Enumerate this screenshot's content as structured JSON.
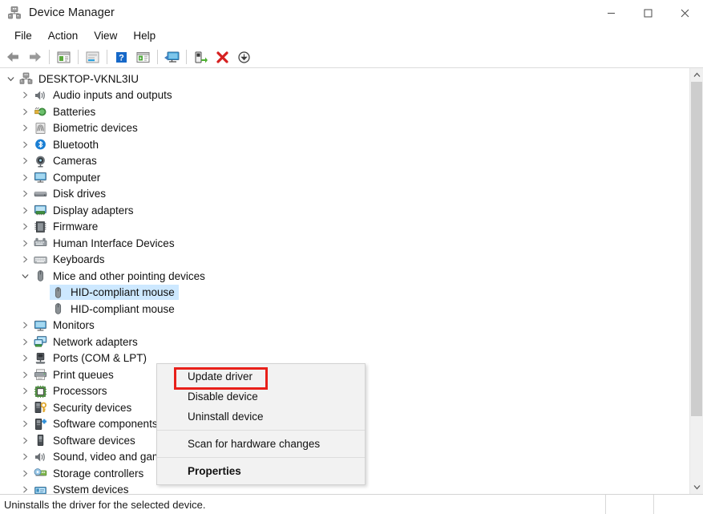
{
  "window": {
    "title": "Device Manager",
    "icon": "device-manager-icon",
    "minimize_label": "—",
    "maximize_label": "□",
    "close_label": "✕"
  },
  "menubar": {
    "items": [
      {
        "label": "File"
      },
      {
        "label": "Action"
      },
      {
        "label": "View"
      },
      {
        "label": "Help"
      }
    ]
  },
  "toolbar": {
    "buttons": [
      {
        "name": "back-icon",
        "tip": "Back"
      },
      {
        "name": "forward-icon",
        "tip": "Forward"
      },
      {
        "name": "properties-icon",
        "tip": "Properties"
      },
      {
        "name": "update-driver-icon",
        "tip": "Update driver"
      },
      {
        "name": "help-icon",
        "tip": "Help"
      },
      {
        "name": "show-hidden-devices-icon",
        "tip": "Show hidden devices"
      },
      {
        "name": "scan-hardware-changes-icon",
        "tip": "Scan for hardware changes"
      },
      {
        "name": "enable-device-icon",
        "tip": "Enable device"
      },
      {
        "name": "uninstall-device-icon",
        "tip": "Uninstall device"
      },
      {
        "name": "disable-device-icon",
        "tip": "Disable device"
      }
    ]
  },
  "tree": {
    "root": "DESKTOP-VKNL3IU",
    "nodes": [
      {
        "label": "DESKTOP-VKNL3IU",
        "depth": 0,
        "state": "expanded",
        "icon": "computer-root-icon",
        "selected": false
      },
      {
        "label": "Audio inputs and outputs",
        "depth": 1,
        "state": "collapsed",
        "icon": "speaker-icon",
        "selected": false
      },
      {
        "label": "Batteries",
        "depth": 1,
        "state": "collapsed",
        "icon": "battery-icon",
        "selected": false
      },
      {
        "label": "Biometric devices",
        "depth": 1,
        "state": "collapsed",
        "icon": "fingerprint-icon",
        "selected": false
      },
      {
        "label": "Bluetooth",
        "depth": 1,
        "state": "collapsed",
        "icon": "bluetooth-icon",
        "selected": false
      },
      {
        "label": "Cameras",
        "depth": 1,
        "state": "collapsed",
        "icon": "camera-icon",
        "selected": false
      },
      {
        "label": "Computer",
        "depth": 1,
        "state": "collapsed",
        "icon": "monitor-icon",
        "selected": false
      },
      {
        "label": "Disk drives",
        "depth": 1,
        "state": "collapsed",
        "icon": "disk-drive-icon",
        "selected": false
      },
      {
        "label": "Display adapters",
        "depth": 1,
        "state": "collapsed",
        "icon": "display-adapter-icon",
        "selected": false
      },
      {
        "label": "Firmware",
        "depth": 1,
        "state": "collapsed",
        "icon": "firmware-chip-icon",
        "selected": false
      },
      {
        "label": "Human Interface Devices",
        "depth": 1,
        "state": "collapsed",
        "icon": "hid-icon",
        "selected": false
      },
      {
        "label": "Keyboards",
        "depth": 1,
        "state": "collapsed",
        "icon": "keyboard-icon",
        "selected": false
      },
      {
        "label": "Mice and other pointing devices",
        "depth": 1,
        "state": "expanded",
        "icon": "mouse-icon",
        "selected": false
      },
      {
        "label": "HID-compliant mouse",
        "depth": 2,
        "state": "leaf",
        "icon": "mouse-icon",
        "selected": true
      },
      {
        "label": "HID-compliant mouse",
        "depth": 2,
        "state": "leaf",
        "icon": "mouse-icon",
        "selected": false
      },
      {
        "label": "Monitors",
        "depth": 1,
        "state": "collapsed",
        "icon": "monitor-icon",
        "selected": false
      },
      {
        "label": "Network adapters",
        "depth": 1,
        "state": "collapsed",
        "icon": "network-adapter-icon",
        "selected": false
      },
      {
        "label": "Ports (COM & LPT)",
        "depth": 1,
        "state": "collapsed",
        "icon": "port-icon",
        "selected": false
      },
      {
        "label": "Print queues",
        "depth": 1,
        "state": "collapsed",
        "icon": "printer-icon",
        "selected": false
      },
      {
        "label": "Processors",
        "depth": 1,
        "state": "collapsed",
        "icon": "processor-icon",
        "selected": false
      },
      {
        "label": "Security devices",
        "depth": 1,
        "state": "collapsed",
        "icon": "security-device-icon",
        "selected": false
      },
      {
        "label": "Software components",
        "depth": 1,
        "state": "collapsed",
        "icon": "software-component-icon",
        "selected": false
      },
      {
        "label": "Software devices",
        "depth": 1,
        "state": "collapsed",
        "icon": "software-device-icon",
        "selected": false
      },
      {
        "label": "Sound, video and game controllers",
        "depth": 1,
        "state": "collapsed",
        "icon": "speaker-icon",
        "selected": false
      },
      {
        "label": "Storage controllers",
        "depth": 1,
        "state": "collapsed",
        "icon": "storage-controller-icon",
        "selected": false
      },
      {
        "label": "System devices",
        "depth": 1,
        "state": "collapsed",
        "icon": "system-device-icon",
        "selected": false
      }
    ]
  },
  "context_menu": {
    "items": [
      {
        "label": "Update driver",
        "bold": false,
        "highlighted": true
      },
      {
        "label": "Disable device",
        "bold": false,
        "highlighted": false
      },
      {
        "label": "Uninstall device",
        "bold": false,
        "highlighted": false
      },
      {
        "separator": true
      },
      {
        "label": "Scan for hardware changes",
        "bold": false,
        "highlighted": false
      },
      {
        "separator": true
      },
      {
        "label": "Properties",
        "bold": true,
        "highlighted": false
      }
    ],
    "highlight_color": "#e8201a"
  },
  "statusbar": {
    "text": "Uninstalls the driver for the selected device."
  },
  "colors": {
    "selection": "#cde8ff",
    "menu_bg": "#f2f2f2",
    "accent_red": "#e8201a",
    "window_bg": "#ffffff",
    "scrollbar_thumb": "#cdcdcd"
  }
}
